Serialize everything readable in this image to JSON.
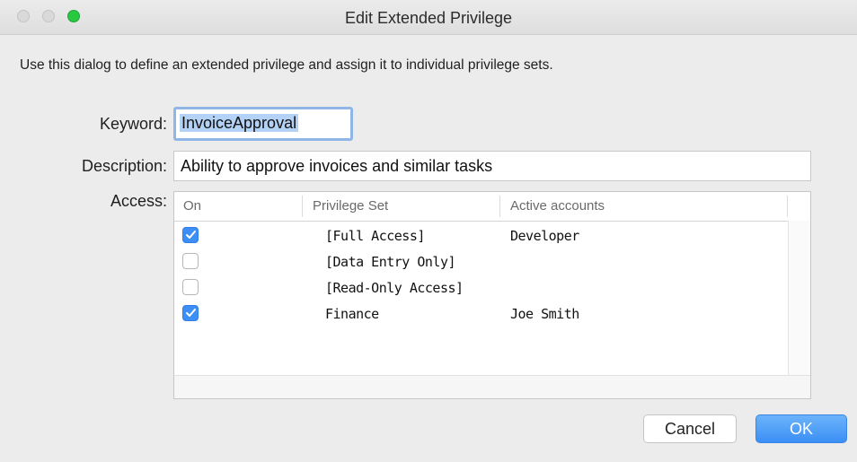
{
  "window": {
    "title": "Edit Extended Privilege"
  },
  "intro_text": "Use this dialog to define an extended privilege and assign it to individual privilege sets.",
  "form": {
    "keyword_label": "Keyword:",
    "keyword_value": "InvoiceApproval",
    "description_label": "Description:",
    "description_value": "Ability to approve invoices and similar tasks",
    "access_label": "Access:"
  },
  "table": {
    "headers": [
      "On",
      "Privilege Set",
      "Active accounts"
    ],
    "rows": [
      {
        "on": true,
        "set": "[Full Access]",
        "accounts": "Developer"
      },
      {
        "on": false,
        "set": "[Data Entry Only]",
        "accounts": ""
      },
      {
        "on": false,
        "set": "[Read-Only Access]",
        "accounts": ""
      },
      {
        "on": true,
        "set": "Finance",
        "accounts": "Joe Smith"
      }
    ]
  },
  "buttons": {
    "cancel": "Cancel",
    "ok": "OK"
  },
  "colors": {
    "accent": "#3d8ef5",
    "zoom_button": "#28c840"
  }
}
